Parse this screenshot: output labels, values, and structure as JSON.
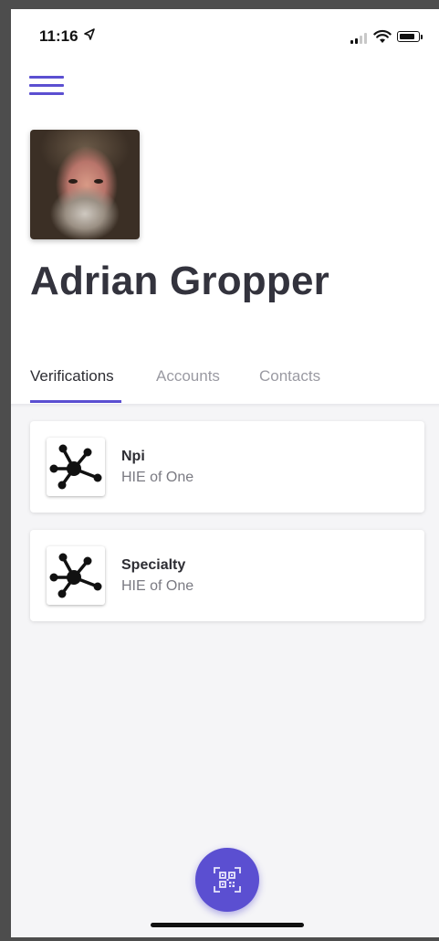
{
  "status_bar": {
    "time": "11:16",
    "location_icon": "location-arrow-icon",
    "signal_icon": "cellular-signal-icon",
    "wifi_icon": "wifi-icon",
    "battery_icon": "battery-icon"
  },
  "header": {
    "menu_icon": "hamburger-menu-icon",
    "user_name": "Adrian Gropper"
  },
  "tabs": [
    {
      "label": "Verifications",
      "active": true
    },
    {
      "label": "Accounts",
      "active": false
    },
    {
      "label": "Contacts",
      "active": false
    }
  ],
  "verifications": [
    {
      "title": "Npi",
      "issuer": "HIE of One",
      "icon": "network-nodes-icon"
    },
    {
      "title": "Specialty",
      "issuer": "HIE of One",
      "icon": "network-nodes-icon"
    }
  ],
  "fab": {
    "icon": "qr-code-icon"
  },
  "colors": {
    "accent": "#5b4fd1",
    "name_text": "#33333d",
    "tab_inactive": "#9a9aa2",
    "background": "#f5f5f7"
  }
}
